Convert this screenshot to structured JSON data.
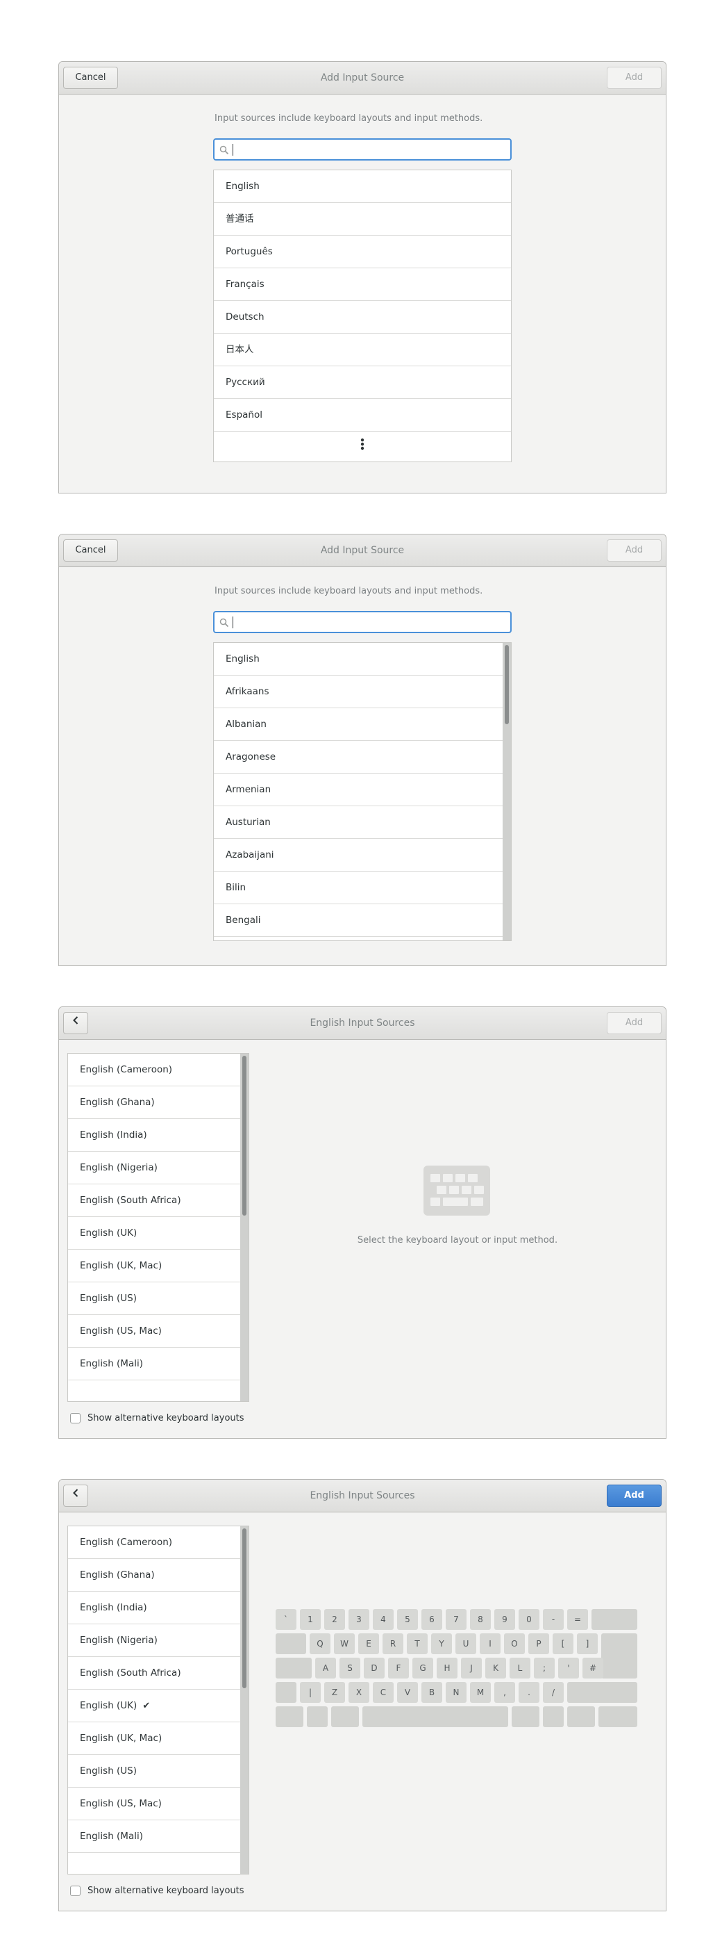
{
  "dialogs": [
    {
      "title": "Add Input Source",
      "cancel_label": "Cancel",
      "add_label": "Add",
      "hint": "Input sources include keyboard layouts and input methods.",
      "search_value": "",
      "languages": [
        "English",
        "普通话",
        "Português",
        "Français",
        "Deutsch",
        "日本人",
        "Русский",
        "Español"
      ]
    },
    {
      "title": "Add Input Source",
      "cancel_label": "Cancel",
      "add_label": "Add",
      "hint": "Input sources include keyboard layouts and input methods.",
      "search_value": "",
      "languages": [
        "English",
        "Afrikaans",
        "Albanian",
        "Aragonese",
        "Armenian",
        "Austurian",
        "Azabaijani",
        "Bilin",
        "Bengali"
      ]
    },
    {
      "title": "English Input Sources",
      "add_label": "Add",
      "layouts": [
        "English (Cameroon)",
        "English (Ghana)",
        "English (India)",
        "English (Nigeria)",
        "English (South Africa)",
        "English (UK)",
        "English (UK, Mac)",
        "English (US)",
        "English (US, Mac)",
        "English (Mali)"
      ],
      "selected_index": null,
      "checkbox_label": "Show alternative keyboard layouts",
      "checkbox_checked": false,
      "empty_message": "Select the keyboard layout or input method."
    },
    {
      "title": "English Input Sources",
      "add_label": "Add",
      "layouts": [
        "English (Cameroon)",
        "English (Ghana)",
        "English (India)",
        "English (Nigeria)",
        "English (South Africa)",
        "English (UK)",
        "English (UK, Mac)",
        "English (US)",
        "English (US, Mac)",
        "English (Mali)"
      ],
      "selected_index": 5,
      "checkbox_label": "Show alternative keyboard layouts",
      "checkbox_checked": false,
      "keyboard_rows": [
        [
          "`",
          "1",
          "2",
          "3",
          "4",
          "5",
          "6",
          "7",
          "8",
          "9",
          "0",
          "-",
          "="
        ],
        [
          "Q",
          "W",
          "E",
          "R",
          "T",
          "Y",
          "U",
          "I",
          "O",
          "P",
          "[",
          "]"
        ],
        [
          "A",
          "S",
          "D",
          "F",
          "G",
          "H",
          "J",
          "K",
          "L",
          ";",
          "'",
          "#"
        ],
        [
          "|",
          "Z",
          "X",
          "C",
          "V",
          "B",
          "N",
          "M",
          ",",
          ".",
          "/"
        ]
      ]
    }
  ],
  "icons": {
    "search": "search-icon",
    "more": "vertical-ellipsis-icon",
    "back": "chevron-left-icon",
    "keyboard": "keyboard-icon",
    "check": "checkmark-icon"
  },
  "colors": {
    "accent": "#4a90d9",
    "add_primary": "#3b7dd0",
    "dialog_bg": "#f3f3f2"
  }
}
